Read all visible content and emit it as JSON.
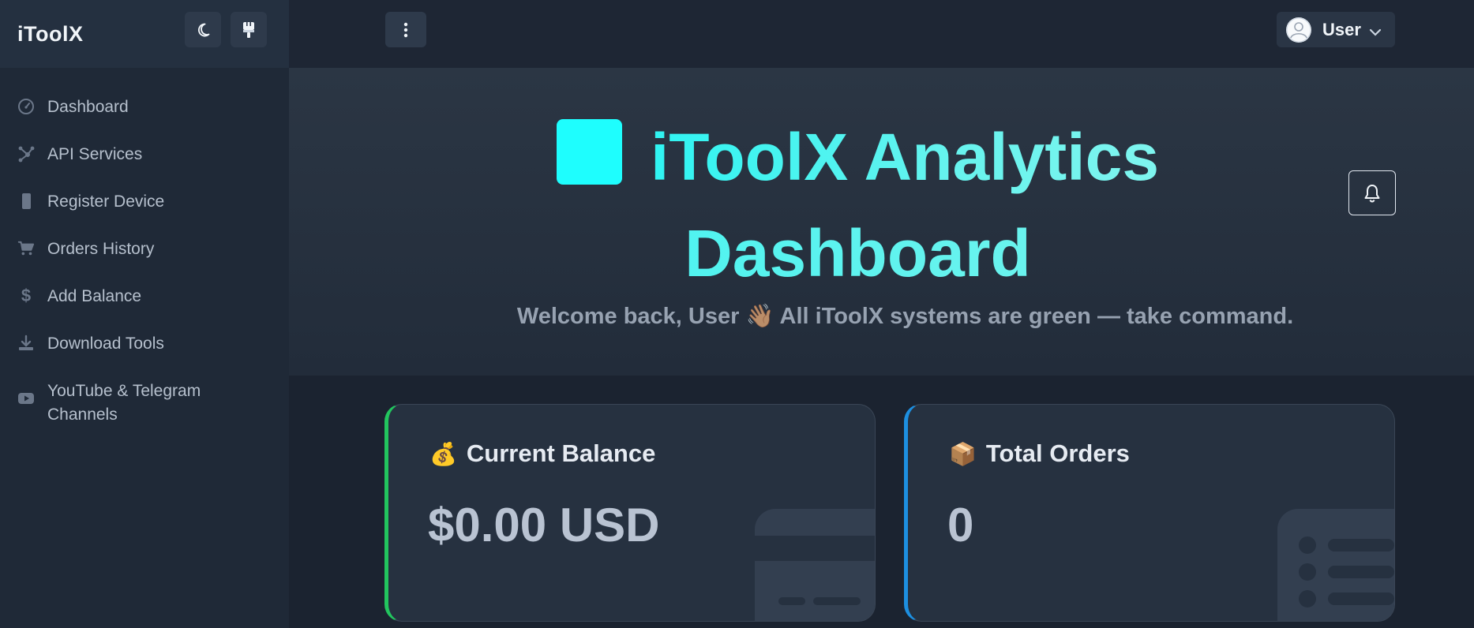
{
  "sidebar": {
    "brand": "iToolX",
    "theme_toggle_icon": "moon-icon",
    "brush_icon": "paintbrush-icon",
    "items": [
      {
        "label": "Dashboard",
        "icon": "speedometer-icon"
      },
      {
        "label": "API Services",
        "icon": "hub-icon"
      },
      {
        "label": "Register Device",
        "icon": "phone-icon"
      },
      {
        "label": "Orders History",
        "icon": "cart-icon"
      },
      {
        "label": "Add Balance",
        "icon": "dollar-icon"
      },
      {
        "label": "Download Tools",
        "icon": "download-icon"
      },
      {
        "label": "YouTube & Telegram Channels",
        "icon": "youtube-icon"
      }
    ]
  },
  "topbar": {
    "menu_icon": "kebab-menu-icon",
    "user_label": "User"
  },
  "hero": {
    "title_line1": "iToolX Analytics",
    "title_line2": "Dashboard",
    "subtitle": "Welcome back, User 👋🏽 All iToolX systems are green — take command."
  },
  "cards": {
    "balance": {
      "emoji": "💰",
      "title": "Current Balance",
      "value": "$0.00 USD",
      "accent": "#22c55e"
    },
    "orders": {
      "emoji": "📦",
      "title": "Total Orders",
      "value": "0",
      "accent": "#1d8fe0"
    }
  },
  "colors": {
    "accent_cyan": "#2ff6f3",
    "sidebar_bg": "#1f2937",
    "page_bg": "#1b2330"
  }
}
